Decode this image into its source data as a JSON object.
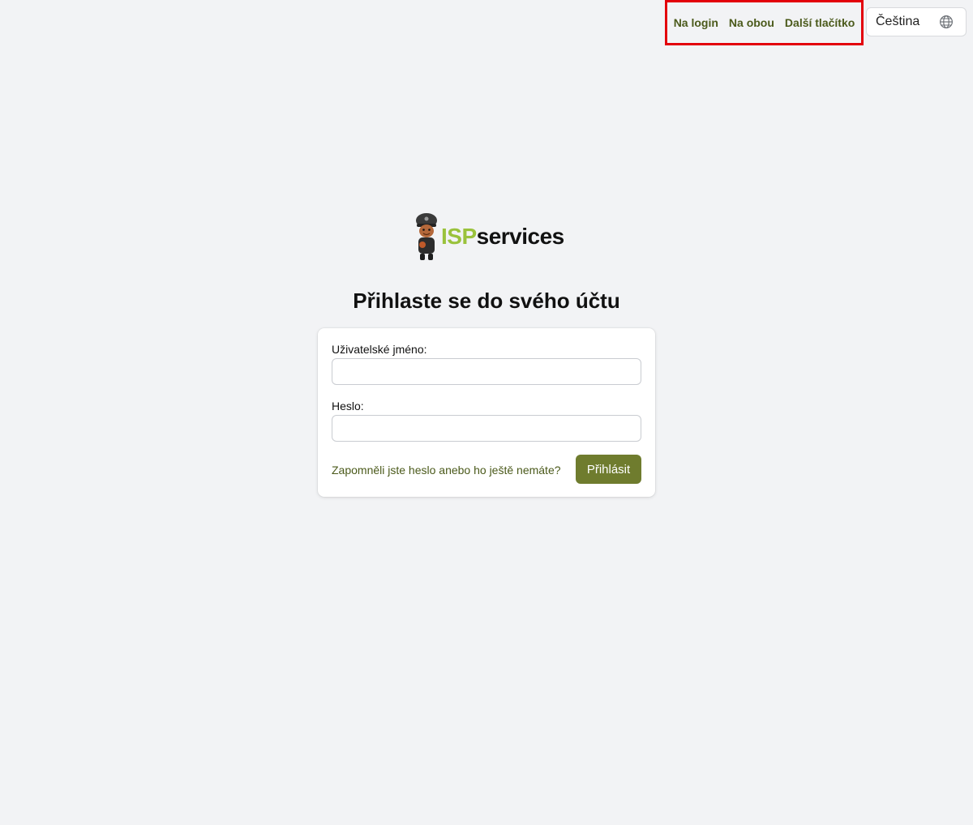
{
  "nav": {
    "links": [
      "Na login",
      "Na obou",
      "Další tlačítko"
    ],
    "highlight_color": "#e3000b"
  },
  "language": {
    "selected": "Čeština",
    "icon": "globe-icon"
  },
  "logo": {
    "isp": "ISP",
    "services": "services",
    "mascot": "police-mascot",
    "colors": {
      "isp": "#9ac23c",
      "services": "#121212"
    }
  },
  "page": {
    "title": "Přihlaste se do svého účtu"
  },
  "form": {
    "username_label": "Uživatelské jméno:",
    "username_value": "",
    "password_label": "Heslo:",
    "password_value": "",
    "forgot_link": "Zapomněli jste heslo anebo ho ještě nemáte?",
    "submit_label": "Přihlásit",
    "accent_color": "#6f7c2e"
  }
}
